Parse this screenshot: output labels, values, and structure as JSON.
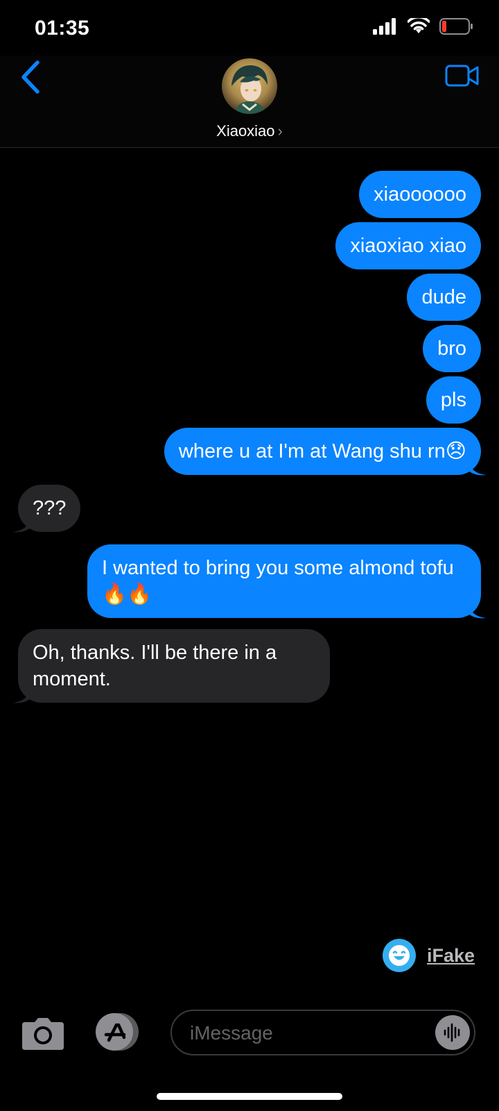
{
  "status_bar": {
    "time": "01:35"
  },
  "header": {
    "contact_name": "Xiaoxiao",
    "chevron": "›"
  },
  "messages": [
    {
      "side": "sent",
      "text": "xiaoooooo"
    },
    {
      "side": "sent",
      "text": "xiaoxiao xiao"
    },
    {
      "side": "sent",
      "text": "dude"
    },
    {
      "side": "sent",
      "text": "bro"
    },
    {
      "side": "sent",
      "text": "pls"
    },
    {
      "side": "sent",
      "text": "where u at I'm at Wang shu rn😞"
    },
    {
      "side": "received",
      "text": "???"
    },
    {
      "side": "sent",
      "text": "I wanted to bring you some almond tofu🔥🔥"
    },
    {
      "side": "received",
      "text": "Oh, thanks. I'll be there in a moment."
    }
  ],
  "watermark": {
    "label": "iFake"
  },
  "input": {
    "placeholder": "iMessage"
  },
  "colors": {
    "sent_bubble": "#0a84ff",
    "received_bubble": "#262628",
    "accent": "#0a84ff"
  },
  "icons": [
    "back-chevron-icon",
    "video-call-icon",
    "camera-icon",
    "app-store-icon",
    "audio-waveform-icon",
    "signal-icon",
    "wifi-icon",
    "battery-icon"
  ]
}
